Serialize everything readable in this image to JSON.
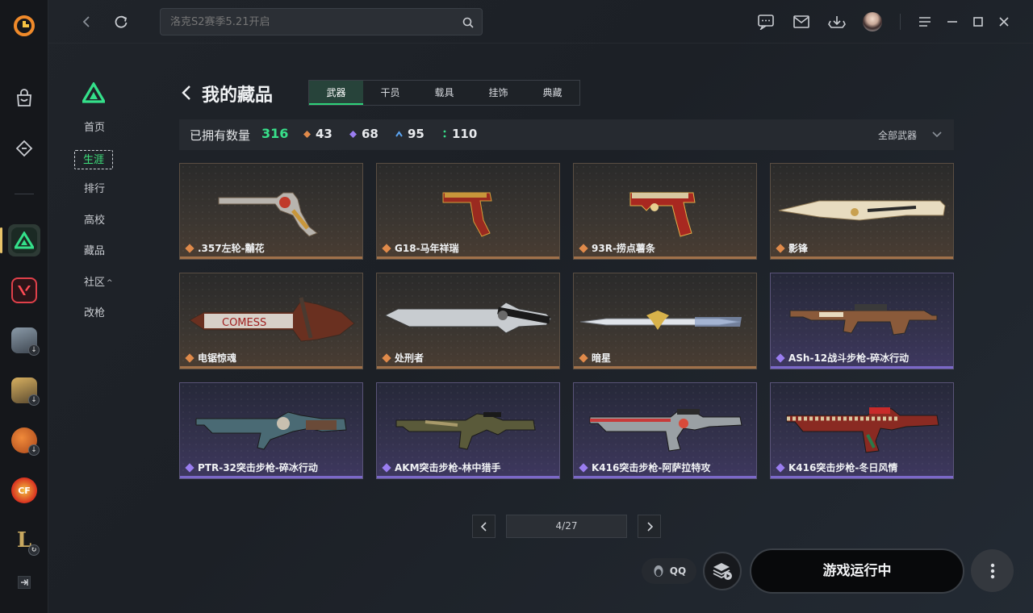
{
  "topbar": {
    "search_placeholder": "洛克S2赛季5.21开启",
    "icons": [
      "back-icon",
      "refresh-icon",
      "chat-icon",
      "mail-icon",
      "download-icon",
      "avatar",
      "menu-icon",
      "minimize-icon",
      "maximize-icon",
      "close-icon"
    ]
  },
  "rail": {
    "icons": [
      "app-logo-icon",
      "shop-icon",
      "tag-icon",
      "valorant-style-game",
      "pubg-game",
      "pubg-mobile-game",
      "basketball-game",
      "crossfire-game",
      "league-game",
      "collapse-icon"
    ]
  },
  "nav": {
    "items": [
      "首页",
      "生涯",
      "排行",
      "高校",
      "藏品",
      "社区",
      "改枪"
    ],
    "selected": "生涯"
  },
  "header": {
    "title": "我的藏品",
    "tabs": [
      "武器",
      "干员",
      "载具",
      "挂饰",
      "典藏"
    ],
    "active_tab": "武器"
  },
  "stats": {
    "owned_label": "已拥有数量",
    "owned_count": "316",
    "q_orange": "43",
    "q_purple": "68",
    "q_blue": "95",
    "q_green": "110",
    "filter_label": "全部武器",
    "colors": {
      "orange": "#e08a4a",
      "purple": "#9a7df0",
      "blue": "#5aa3f0",
      "green": "#38e08a"
    }
  },
  "cards": [
    {
      "name": ".357左轮-黼花",
      "tier": "gold"
    },
    {
      "name": "G18-马年祥瑞",
      "tier": "gold"
    },
    {
      "name": "93R-捞点薯条",
      "tier": "gold"
    },
    {
      "name": "影锋",
      "tier": "gold"
    },
    {
      "name": "电锯惊魂",
      "tier": "gold"
    },
    {
      "name": "处刑者",
      "tier": "gold"
    },
    {
      "name": "暗星",
      "tier": "gold"
    },
    {
      "name": "ASh-12战斗步枪-碎冰行动",
      "tier": "purple"
    },
    {
      "name": "PTR-32突击步枪-碎冰行动",
      "tier": "purple"
    },
    {
      "name": "AKM突击步枪-林中猎手",
      "tier": "purple"
    },
    {
      "name": "K416突击步枪-阿萨拉特攻",
      "tier": "purple"
    },
    {
      "name": "K416突击步枪-冬日风情",
      "tier": "purple"
    }
  ],
  "pager": {
    "text": "4/27"
  },
  "bottom": {
    "qq_label": "QQ",
    "play_label": "游戏运行中"
  }
}
